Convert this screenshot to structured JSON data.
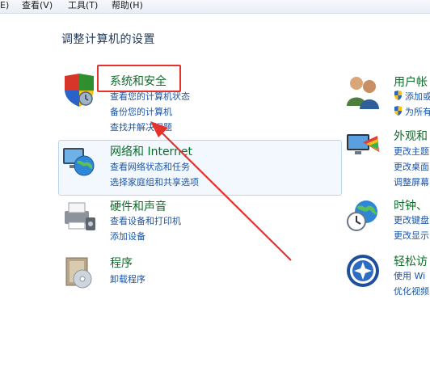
{
  "menubar": {
    "items": [
      "E)",
      "查看(V)",
      "工具(T)",
      "帮助(H)"
    ]
  },
  "page_title": "调整计算机的设置",
  "categories": [
    {
      "title": "系统和安全",
      "links": [
        "查看您的计算机状态",
        "备份您的计算机",
        "查找并解决问题"
      ]
    },
    {
      "title": "网络和 Internet",
      "links": [
        "查看网络状态和任务",
        "选择家庭组和共享选项"
      ]
    },
    {
      "title": "硬件和声音",
      "links": [
        "查看设备和打印机",
        "添加设备"
      ]
    },
    {
      "title": "程序",
      "links": [
        "卸载程序"
      ]
    },
    {
      "title": "用户帐",
      "links": [
        "添加或",
        "为所有"
      ]
    },
    {
      "title": "外观和",
      "links": [
        "更改主题",
        "更改桌面",
        "调整屏幕"
      ]
    },
    {
      "title": "时钟、",
      "links": [
        "更改键盘",
        "更改显示"
      ]
    },
    {
      "title": "轻松访",
      "links": [
        "使用 Wi",
        "优化视频"
      ]
    }
  ],
  "colors": {
    "category_title": "#0f6b2a",
    "link": "#1b54a6",
    "annotation_red": "#e5322d"
  },
  "icons": [
    "shield-icon",
    "network-globe-icon",
    "printer-icon",
    "programs-disc-icon",
    "users-icon",
    "appearance-monitor-icon",
    "clock-globe-icon",
    "ease-of-access-icon"
  ]
}
